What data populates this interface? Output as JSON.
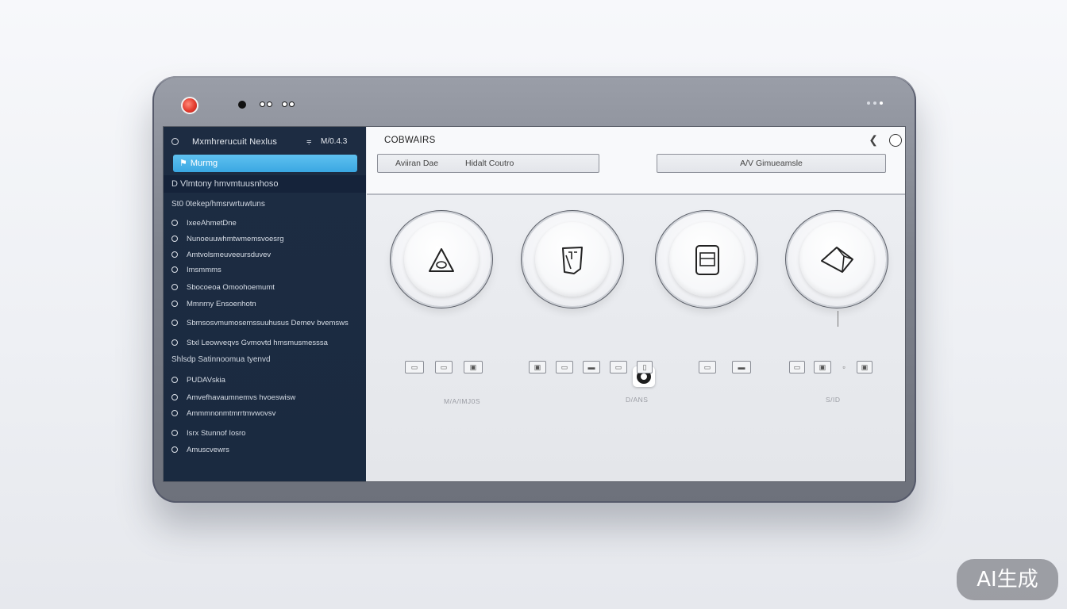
{
  "device": {
    "indicator_color": "#e33b2e",
    "icons": [
      "record-indicator",
      "camera-dot",
      "status-dots"
    ]
  },
  "sidebar": {
    "title": "Mxmhrerucuit Nexlus",
    "filter_icon": "filter-icon",
    "count": "M/0.4.3",
    "active_item": "Murmg",
    "active_item_icon": "flag-icon",
    "subheader": "D Vlmtony hmvmtuusnhoso",
    "section1": "St0 0tekep/hmsrwrtuwtuns",
    "items1": [
      "IxeeAhmetDne",
      "Nunoeuuwhmtwmemsvoesrg",
      "Amtvolsmeuveeursduvev",
      "Imsmmms",
      "Sbocoeoa Omoohoemumt",
      "Mmnrny Ensoenhotn",
      "Sbmsosvmumosemssuuhusus Demev bvemsws",
      "Stxl Leowveqvs Gvmovtd hmsmusmesssa"
    ],
    "section2": "Shlsdp Satinnoomua tyenvd",
    "items2": [
      "PUDAVskia",
      "Amvefhavaumnemvs hvoeswisw",
      "Ammmnonmtmrrtmvwovsv",
      "Isrx Stunnof Iosro",
      "Amuscvewrs"
    ]
  },
  "toolbar": {
    "title": "COBWAIRS",
    "back_icon": "chevron-left-icon",
    "circle_icon": "circle-icon",
    "field1_left": "Aviiran Dae",
    "field1_right": "Hidalt Coutro",
    "field2": "A/V Gimueamsle"
  },
  "content": {
    "tiles": [
      {
        "icon": "triangle-icon"
      },
      {
        "icon": "clipboard-icon"
      },
      {
        "icon": "document-icon"
      },
      {
        "icon": "diamond-icon"
      }
    ],
    "captions": [
      "M/A/IMJ0S",
      "D/ANS",
      "S/ID"
    ],
    "eye_icon": "eye-icon",
    "small_icons": [
      "img",
      "img",
      "img",
      "img",
      "img",
      "img",
      "img",
      "img",
      "img",
      "img",
      "img",
      "img",
      "img"
    ]
  },
  "watermark": "AI生成"
}
